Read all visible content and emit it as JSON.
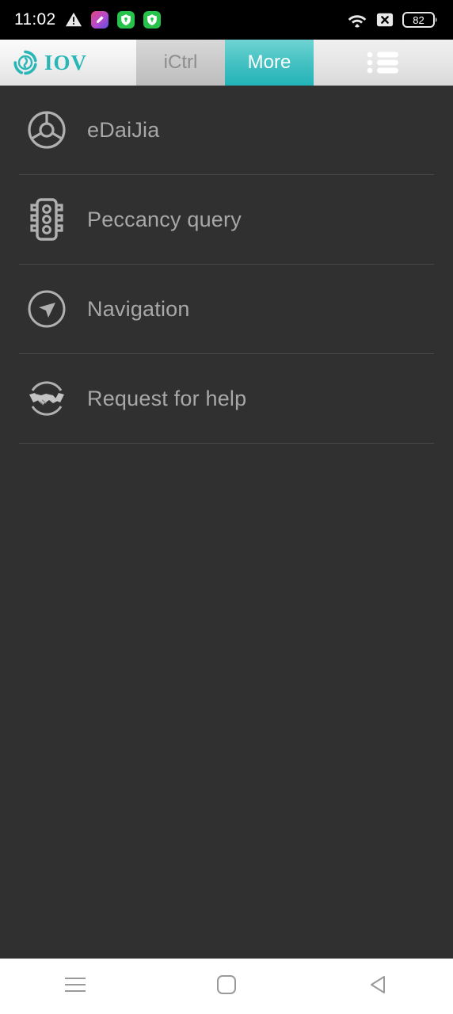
{
  "status_bar": {
    "time": "11:02",
    "left_icons": [
      {
        "name": "warning-triangle-icon",
        "label": "warning"
      },
      {
        "name": "app-notification-icon",
        "label": "app"
      },
      {
        "name": "shield-green-icon-1",
        "label": "security"
      },
      {
        "name": "shield-green-icon-2",
        "label": "security"
      }
    ],
    "right_icons": [
      {
        "name": "wifi-icon",
        "label": "wifi"
      },
      {
        "name": "no-sim-icon",
        "label": "no-signal"
      }
    ],
    "battery_level": "82"
  },
  "app_bar": {
    "logo_text": "IOV",
    "logo_icon": "iov-swirl-logo-icon",
    "tabs": [
      {
        "label": "iCtrl",
        "active": false
      },
      {
        "label": "More",
        "active": true
      }
    ],
    "menu_icon": "list-menu-icon",
    "accent_color": "#29b6b6"
  },
  "menu": {
    "items": [
      {
        "label": "eDaiJia",
        "icon": "steering-wheel-icon"
      },
      {
        "label": "Peccancy query",
        "icon": "traffic-light-icon"
      },
      {
        "label": "Navigation",
        "icon": "navigation-arrow-icon"
      },
      {
        "label": "Request for help",
        "icon": "handshake-icon"
      }
    ]
  },
  "nav_bar": {
    "buttons": [
      {
        "name": "recent-apps-button",
        "icon": "hamburger-icon"
      },
      {
        "name": "home-button",
        "icon": "rounded-square-icon"
      },
      {
        "name": "back-button",
        "icon": "triangle-left-icon"
      }
    ]
  },
  "colors": {
    "background": "#303030",
    "accent": "#29b6b6",
    "text": "#a8a8a8",
    "divider": "#4a4a4a"
  }
}
